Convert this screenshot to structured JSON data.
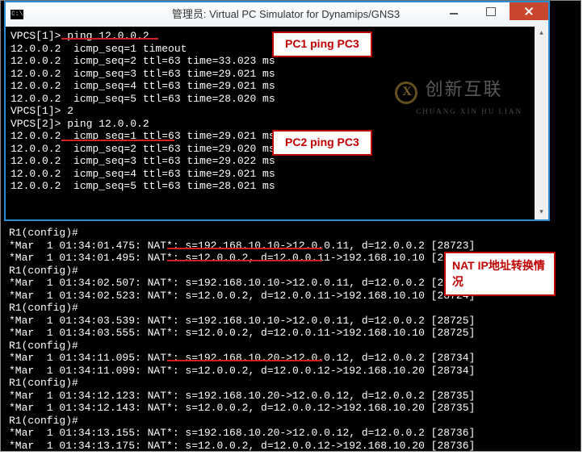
{
  "window": {
    "title": "管理员:  Virtual PC Simulator for Dynamips/GNS3"
  },
  "callouts": {
    "c1": "PC1 ping PC3",
    "c2": "PC2 ping PC3",
    "c3": "NAT IP地址转换情况"
  },
  "watermark": {
    "brand": "创新互联",
    "py": "CHUANG XIN HU LIAN"
  },
  "inner_terminal": [
    "VPCS[1]> ping 12.0.0.2",
    "12.0.0.2  icmp_seq=1 timeout",
    "12.0.0.2  icmp_seq=2 ttl=63 time=33.023 ms",
    "12.0.0.2  icmp_seq=3 ttl=63 time=29.021 ms",
    "12.0.0.2  icmp_seq=4 ttl=63 time=29.021 ms",
    "12.0.0.2  icmp_seq=5 ttl=63 time=28.020 ms",
    "",
    "VPCS[1]> 2",
    "VPCS[2]> ping 12.0.0.2",
    "12.0.0.2  icmp_seq=1 ttl=63 time=29.021 ms",
    "12.0.0.2  icmp_seq=2 ttl=63 time=29.020 ms",
    "12.0.0.2  icmp_seq=3 ttl=63 time=29.022 ms",
    "12.0.0.2  icmp_seq=4 ttl=63 time=29.021 ms",
    "12.0.0.2  icmp_seq=5 ttl=63 time=28.021 ms"
  ],
  "outer_terminal": [
    "R1(config)#",
    "*Mar  1 01:34:01.475: NAT*: s=192.168.10.10->12.0.0.11, d=12.0.0.2 [28723]",
    "*Mar  1 01:34:01.495: NAT*: s=12.0.0.2, d=12.0.0.11->192.168.10.10 [28723]",
    "R1(config)#",
    "*Mar  1 01:34:02.507: NAT*: s=192.168.10.10->12.0.0.11, d=12.0.0.2 [28724]",
    "*Mar  1 01:34:02.523: NAT*: s=12.0.0.2, d=12.0.0.11->192.168.10.10 [28724]",
    "R1(config)#",
    "*Mar  1 01:34:03.539: NAT*: s=192.168.10.10->12.0.0.11, d=12.0.0.2 [28725]",
    "*Mar  1 01:34:03.555: NAT*: s=12.0.0.2, d=12.0.0.11->192.168.10.10 [28725]",
    "R1(config)#",
    "*Mar  1 01:34:11.095: NAT*: s=192.168.10.20->12.0.0.12, d=12.0.0.2 [28734]",
    "*Mar  1 01:34:11.099: NAT*: s=12.0.0.2, d=12.0.0.12->192.168.10.20 [28734]",
    "R1(config)#",
    "*Mar  1 01:34:12.123: NAT*: s=192.168.10.20->12.0.0.12, d=12.0.0.2 [28735]",
    "*Mar  1 01:34:12.143: NAT*: s=12.0.0.2, d=12.0.0.12->192.168.10.20 [28735]",
    "R1(config)#",
    "*Mar  1 01:34:13.155: NAT*: s=192.168.10.20->12.0.0.12, d=12.0.0.2 [28736]",
    "*Mar  1 01:34:13.175: NAT*: s=12.0.0.2, d=12.0.0.12->192.168.10.20 [28736]"
  ]
}
